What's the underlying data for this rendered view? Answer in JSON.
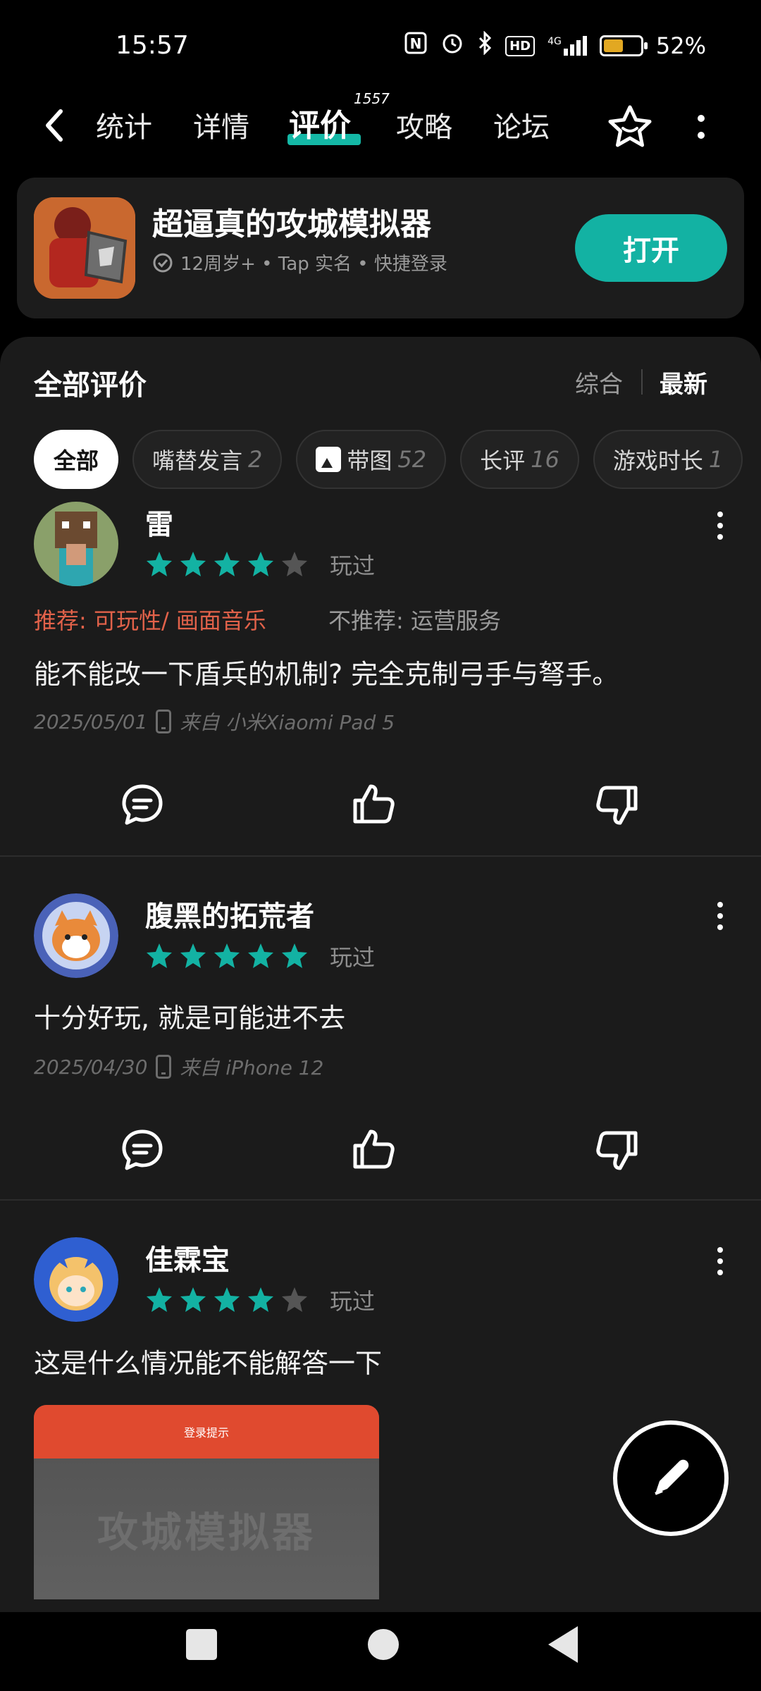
{
  "status": {
    "time": "15:57",
    "network": "4G",
    "hd": "HD",
    "battery": "52%",
    "battery_level": 0.52
  },
  "nav": {
    "tabs": [
      {
        "label": "统计"
      },
      {
        "label": "详情"
      },
      {
        "label": "评价",
        "badge": "1557"
      },
      {
        "label": "攻略"
      },
      {
        "label": "论坛"
      }
    ],
    "active_tab": 2
  },
  "app": {
    "title": "超逼真的攻城模拟器",
    "subtitle": "12周岁+ • Tap 实名 • 快捷登录",
    "open_label": "打开",
    "accent": "#13b2a3"
  },
  "reviews_header": {
    "title": "全部评价",
    "sort_comprehensive": "综合",
    "sort_newest": "最新"
  },
  "filters": [
    {
      "label": "全部",
      "count": ""
    },
    {
      "label": "嘴替发言",
      "count": "2"
    },
    {
      "label": "带图",
      "count": "52"
    },
    {
      "label": "长评",
      "count": "16"
    },
    {
      "label": "游戏时长",
      "count": "1"
    }
  ],
  "reviews": [
    {
      "name": "雷",
      "rating": 4,
      "status": "玩过",
      "recommend": "推荐: 可玩性/ 画面音乐",
      "not_recommend": "不推荐: 运营服务",
      "text": "能不能改一下盾兵的机制? 完全克制弓手与弩手。",
      "date": "2025/05/01",
      "device": "来自 小米Xiaomi Pad 5"
    },
    {
      "name": "腹黑的拓荒者",
      "rating": 5,
      "status": "玩过",
      "text": "十分好玩, 就是可能进不去",
      "date": "2025/04/30",
      "device": "来自 iPhone 12"
    },
    {
      "name": "佳霖宝",
      "rating": 4,
      "status": "玩过",
      "text": "这是什么情况能不能解答一下",
      "image_caption": "登录提示",
      "image_title": "攻城模拟器"
    }
  ]
}
